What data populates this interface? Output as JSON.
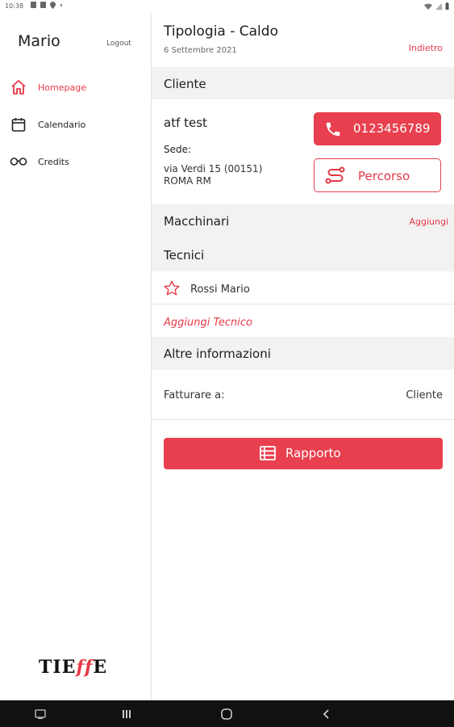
{
  "status_bar": {
    "time": "10:38"
  },
  "sidebar": {
    "user_name": "Mario",
    "logout_label": "Logout",
    "items": [
      {
        "label": "Homepage",
        "icon": "home-icon",
        "active": true
      },
      {
        "label": "Calendario",
        "icon": "calendar-icon",
        "active": false
      },
      {
        "label": "Credits",
        "icon": "glasses-icon",
        "active": false
      }
    ],
    "logo": {
      "part1": "TIE",
      "part2": "ff",
      "part3": "E"
    }
  },
  "header": {
    "title": "Tipologia - Caldo",
    "date": "6 Settembre 2021",
    "back_label": "Indietro"
  },
  "cliente": {
    "section_label": "Cliente",
    "name": "atf test",
    "sede_label": "Sede:",
    "address_line1": "via Verdi 15 (00151)",
    "address_line2": "ROMA RM",
    "phone": "0123456789",
    "route_label": "Percorso"
  },
  "macchinari": {
    "section_label": "Macchinari",
    "add_label": "Aggiungi"
  },
  "tecnici": {
    "section_label": "Tecnici",
    "items": [
      {
        "name": "Rossi Mario",
        "icon": "star-outline-icon"
      }
    ],
    "add_label": "Aggiungi Tecnico"
  },
  "altre_info": {
    "section_label": "Altre informazioni",
    "fatturare_label": "Fatturare a:",
    "fatturare_value": "Cliente"
  },
  "report_button": {
    "label": "Rapporto",
    "icon": "list-icon"
  },
  "colors": {
    "accent": "#e8404f",
    "section_bg": "#f2f2f2",
    "nav_bar": "#111111"
  }
}
